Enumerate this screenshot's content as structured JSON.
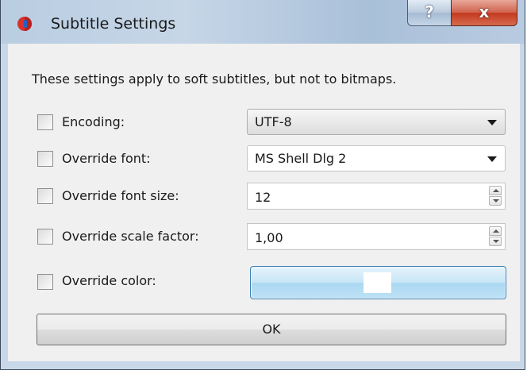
{
  "window": {
    "title": "Subtitle Settings",
    "help_label": "?",
    "close_label": "x"
  },
  "description": "These settings apply to soft subtitles, but not to bitmaps.",
  "rows": [
    {
      "label": "Encoding:",
      "checked": false,
      "control": "combo",
      "value": "UTF-8"
    },
    {
      "label": "Override font:",
      "checked": false,
      "control": "combo",
      "value": "MS Shell Dlg 2"
    },
    {
      "label": "Override font size:",
      "checked": false,
      "control": "spinbox",
      "value": "12"
    },
    {
      "label": "Override scale factor:",
      "checked": false,
      "control": "spinbox",
      "value": "1,00"
    },
    {
      "label": "Override color:",
      "checked": false,
      "control": "color-button",
      "color": "#ffffff"
    }
  ],
  "ok_label": "OK",
  "icons": {
    "app": "player-icon",
    "help": "help-icon",
    "close": "close-icon",
    "combo_arrow": "chevron-down-icon",
    "spin_up": "arrow-up-icon",
    "spin_down": "arrow-down-icon"
  }
}
